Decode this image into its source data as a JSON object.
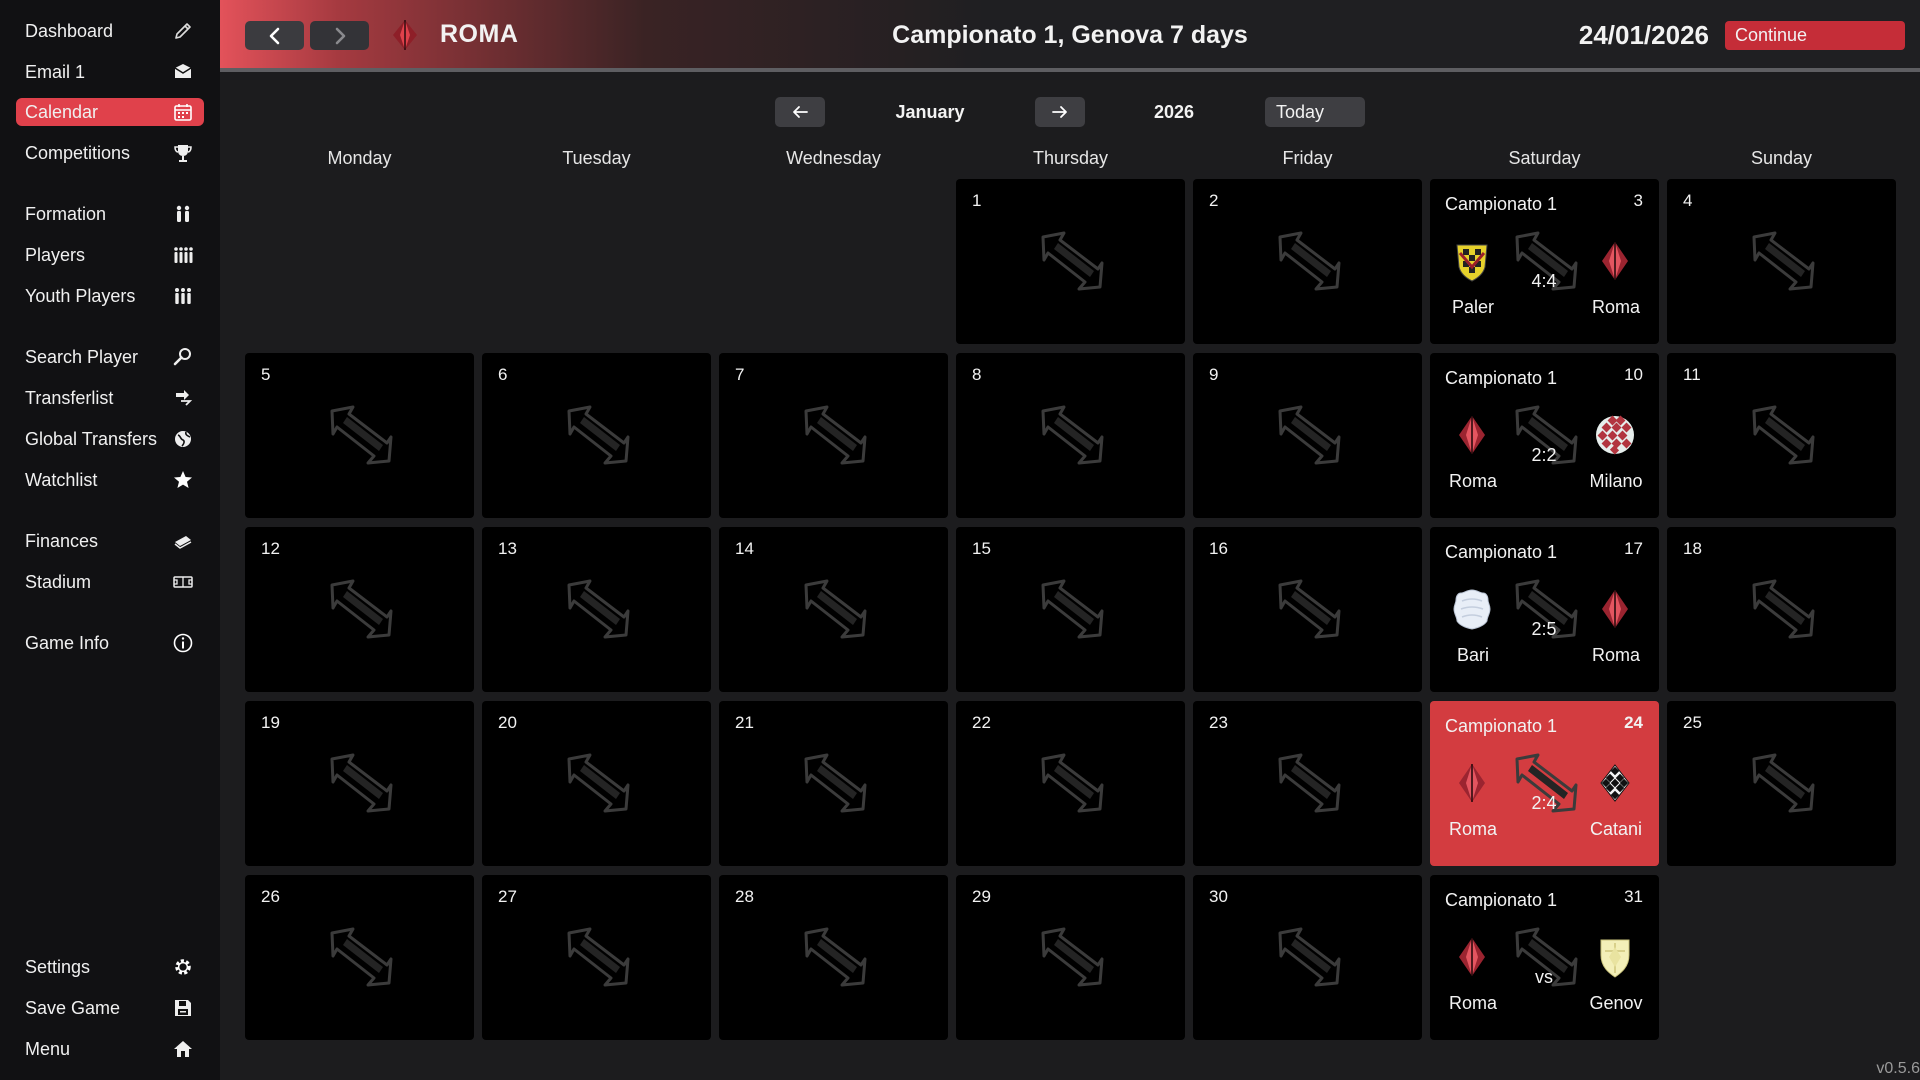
{
  "sidebar": {
    "items": [
      {
        "label": "Dashboard",
        "icon": "pencil-icon",
        "active": false
      },
      {
        "label": "Email 1",
        "icon": "envelope-icon",
        "active": false
      },
      {
        "label": "Calendar",
        "icon": "calendar-icon",
        "active": true
      },
      {
        "label": "Competitions",
        "icon": "trophy-icon",
        "active": false
      },
      {
        "label": "Formation",
        "icon": "formation-icon",
        "active": false
      },
      {
        "label": "Players",
        "icon": "players-icon",
        "active": false
      },
      {
        "label": "Youth Players",
        "icon": "youth-players-icon",
        "active": false
      },
      {
        "label": "Search Player",
        "icon": "search-icon",
        "active": false
      },
      {
        "label": "Transferlist",
        "icon": "transfer-icon",
        "active": false
      },
      {
        "label": "Global Transfers",
        "icon": "globe-icon",
        "active": false
      },
      {
        "label": "Watchlist",
        "icon": "star-icon",
        "active": false
      },
      {
        "label": "Finances",
        "icon": "money-icon",
        "active": false
      },
      {
        "label": "Stadium",
        "icon": "stadium-icon",
        "active": false
      },
      {
        "label": "Game Info",
        "icon": "info-icon",
        "active": false
      },
      {
        "label": "Settings",
        "icon": "gear-icon",
        "active": false
      },
      {
        "label": "Save Game",
        "icon": "save-icon",
        "active": false
      },
      {
        "label": "Menu",
        "icon": "home-icon",
        "active": false
      }
    ]
  },
  "header": {
    "club_name": "ROMA",
    "club_badge": "roma-badge-icon",
    "title": "Campionato 1, Genova 7 days",
    "date": "24/01/2026",
    "continue_label": "Continue",
    "back_icon": "chevron-left-icon",
    "forward_icon": "chevron-right-icon"
  },
  "calendar_nav": {
    "month": "January",
    "year": "2026",
    "today_label": "Today",
    "prev_icon": "arrow-left-icon",
    "next_icon": "arrow-right-icon"
  },
  "weekdays": [
    "Monday",
    "Tuesday",
    "Wednesday",
    "Thursday",
    "Friday",
    "Saturday",
    "Sunday"
  ],
  "first_weekday_index": 3,
  "days_in_month": 31,
  "today": 24,
  "matches": [
    {
      "day": 3,
      "competition": "Campionato 1",
      "home": "Paler",
      "away": "Roma",
      "score": "4:4",
      "home_badge": "palermo-badge-icon",
      "away_badge": "roma-badge-icon"
    },
    {
      "day": 10,
      "competition": "Campionato 1",
      "home": "Roma",
      "away": "Milano",
      "score": "2:2",
      "home_badge": "roma-badge-icon",
      "away_badge": "milano-badge-icon"
    },
    {
      "day": 17,
      "competition": "Campionato 1",
      "home": "Bari",
      "away": "Roma",
      "score": "2:5",
      "home_badge": "bari-badge-icon",
      "away_badge": "roma-badge-icon"
    },
    {
      "day": 24,
      "competition": "Campionato 1",
      "home": "Roma",
      "away": "Catani",
      "score": "2:4",
      "home_badge": "roma-badge-icon",
      "away_badge": "catania-badge-icon"
    },
    {
      "day": 31,
      "competition": "Campionato 1",
      "home": "Roma",
      "away": "Genov",
      "score": "vs",
      "home_badge": "roma-badge-icon",
      "away_badge": "genova-badge-icon"
    }
  ],
  "version": "v0.5.6",
  "colors": {
    "accent": "#e0414b",
    "today_cell": "#d33c40",
    "sidebar_bg": "#111113",
    "cell_bg": "#000000",
    "page_bg": "#1c1c1e"
  }
}
